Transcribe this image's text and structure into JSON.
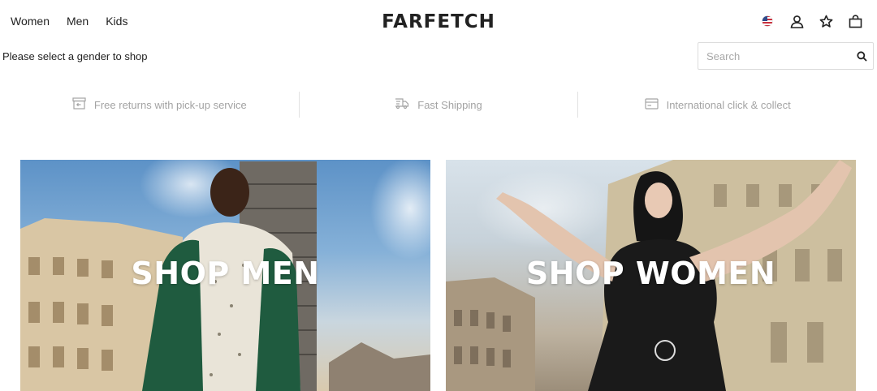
{
  "header": {
    "nav": [
      {
        "label": "Women"
      },
      {
        "label": "Men"
      },
      {
        "label": "Kids"
      }
    ],
    "logo": "FARFETCH",
    "icons": [
      {
        "name": "us-flag-icon"
      },
      {
        "name": "account-icon"
      },
      {
        "name": "wishlist-star-icon"
      },
      {
        "name": "shopping-bag-icon"
      }
    ]
  },
  "prompt": "Please select a gender to shop",
  "search": {
    "placeholder": "Search",
    "value": "",
    "icon": "search-icon"
  },
  "benefits": [
    {
      "label": "Free returns with pick-up service",
      "icon": "returns-icon"
    },
    {
      "label": "Fast Shipping",
      "icon": "shipping-icon"
    },
    {
      "label": "International click & collect",
      "icon": "collect-icon"
    }
  ],
  "banners": [
    {
      "title": "SHOP MEN"
    },
    {
      "title": "SHOP WOMEN"
    }
  ],
  "colors": {
    "text": "#222222",
    "muted": "#a3a3a3",
    "banner_text": "#ffffff"
  }
}
